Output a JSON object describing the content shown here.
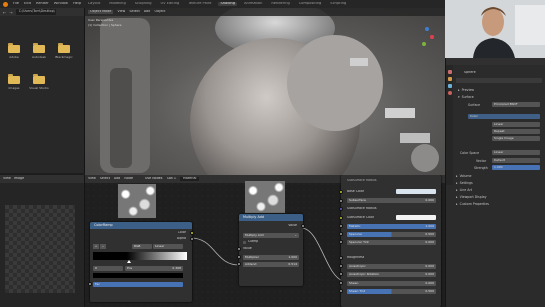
{
  "topbar": {
    "menus": [
      "File",
      "Edit",
      "Render",
      "Window",
      "Help"
    ],
    "workspaces": [
      "Layout",
      "Modeling",
      "Sculpting",
      "UV Editing",
      "Texture Paint",
      "Shading",
      "Animation",
      "Rendering",
      "Compositing",
      "Scripting"
    ],
    "active_workspace": "Shading"
  },
  "filebrowser": {
    "path": "C:\\Users\\Tom\\Desktop\\",
    "folders": [
      "Adobe",
      "Autodesk",
      "Blackmagic",
      "Images",
      "Visual Studio"
    ]
  },
  "viewport": {
    "mode": "Object Mode",
    "menus": [
      "View",
      "Select",
      "Add",
      "Object"
    ],
    "overlay_lines": [
      "User Perspective",
      "(1) Collection | Sphere"
    ]
  },
  "properties": {
    "search_placeholder": "",
    "object_name": "Sphere",
    "material_name": "Material",
    "sections": [
      "Preview",
      "Surface"
    ],
    "surface_label": "Surface",
    "surface_value": "Principled BSDF",
    "rows": [
      {
        "label": "Base Color",
        "value": "Color"
      },
      {
        "label": "Linear",
        "value": "Linear"
      },
      {
        "label": "",
        "value": "Repeat"
      },
      {
        "label": "",
        "value": "Single Image"
      },
      {
        "label": "Color Space",
        "value": "Linear"
      },
      {
        "label": "Vector",
        "value": "Default"
      },
      {
        "label": "Strength",
        "value": "1.000"
      }
    ],
    "bottom_sections": [
      "Volume",
      "Settings",
      "Line Art",
      "Viewport Display",
      "Custom Properties"
    ]
  },
  "leftpanel": {
    "header_menus": [
      "View",
      "Image"
    ]
  },
  "node_editor": {
    "header_menus": [
      "View",
      "Select",
      "Add",
      "Node"
    ],
    "use_nodes_label": "Use Nodes",
    "slot_label": "Slot 1",
    "material_name": "Material",
    "colorramp": {
      "title": "ColorRamp",
      "outputs": [
        "Color",
        "Alpha"
      ],
      "mode": "RGB",
      "interpolation": "Linear",
      "index": "0",
      "pos_label": "Pos",
      "pos_value": "0.368",
      "input": "Fac"
    },
    "multiply": {
      "title": "Multiply Add",
      "output": "Value",
      "operation": "Multiply Add",
      "clamp_label": "Clamp",
      "input_label": "Value",
      "multiplier_label": "Multiplier",
      "multiplier_value": "1.000",
      "addend_label": "Addend",
      "addend_value": "0.514"
    },
    "bsdf": {
      "heading": "Subsurface Radius",
      "rows": [
        {
          "label": "Base Color",
          "value": ""
        },
        {
          "label": "Subsurface",
          "value": "0.000"
        },
        {
          "label": "Subsurface Radius",
          "value": ""
        },
        {
          "label": "Subsurface Color",
          "value": ""
        },
        {
          "label": "Metallic",
          "value": "1.000"
        },
        {
          "label": "Specular",
          "value": "0.500"
        },
        {
          "label": "Specular Tint",
          "value": "0.000"
        },
        {
          "label": "Roughness",
          "value": ""
        },
        {
          "label": "Anisotropic",
          "value": "0.000"
        },
        {
          "label": "Anisotropic Rotation",
          "value": "0.000"
        },
        {
          "label": "Sheen",
          "value": "0.000"
        },
        {
          "label": "Sheen Tint",
          "value": "0.500"
        }
      ]
    }
  },
  "colors": {
    "accent_blue": "#4772b3",
    "node_header_blue": "#3b5f86",
    "orange": "#e87d0d"
  }
}
